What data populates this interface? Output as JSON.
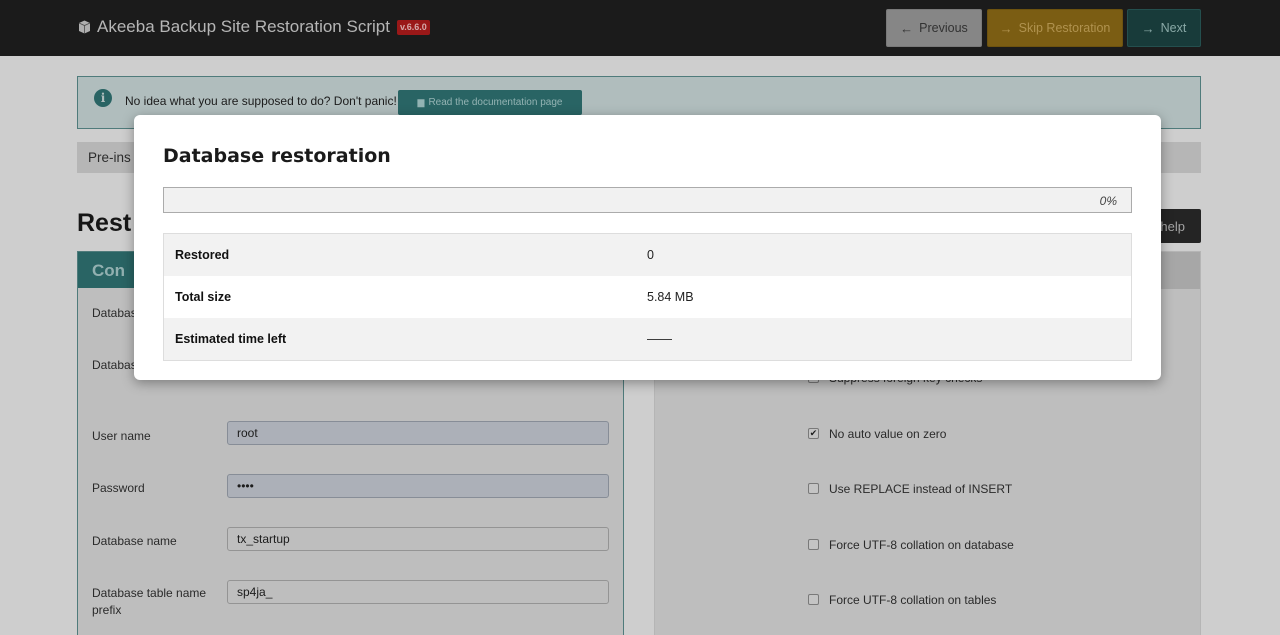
{
  "header": {
    "title": "Akeeba Backup Site Restoration Script",
    "version": "v.6.6.0",
    "buttons": {
      "previous": "Previous",
      "skip": "Skip Restoration",
      "next": "Next"
    }
  },
  "alert": {
    "text": "No idea what you are supposed to do? Don't panic!",
    "doc_button": "Read the documentation page"
  },
  "steps": {
    "current": "Pre-ins"
  },
  "section": {
    "title": "Rest",
    "help_button": "help"
  },
  "connection_panel": {
    "heading": "Con",
    "fields": [
      {
        "label": "Databas",
        "value": ""
      },
      {
        "label": "Databas name",
        "value": ""
      },
      {
        "label": "User name",
        "value": "root"
      },
      {
        "label": "Password",
        "value": "••••"
      },
      {
        "label": "Database name",
        "value": "tx_startup"
      },
      {
        "label": "Database table name prefix",
        "value": "sp4ja_"
      }
    ]
  },
  "options_panel": {
    "checkboxes": [
      {
        "label": "Suppress foreign key checks",
        "checked": false
      },
      {
        "label": "No auto value on zero",
        "checked": true
      },
      {
        "label": "Use REPLACE instead of INSERT",
        "checked": false
      },
      {
        "label": "Force UTF-8 collation on database",
        "checked": false
      },
      {
        "label": "Force UTF-8 collation on tables",
        "checked": false
      }
    ]
  },
  "modal": {
    "title": "Database restoration",
    "progress_percent": 0,
    "progress_label": "0%",
    "stats": [
      {
        "label": "Restored",
        "value": "0"
      },
      {
        "label": "Total size",
        "value": "5.84 MB"
      },
      {
        "label": "Estimated time left",
        "value": "——"
      }
    ]
  },
  "colors": {
    "primary": "#2f7272",
    "warning": "#e0a52b",
    "version_badge": "#b01c1c",
    "header_bg": "#1f1f1f"
  }
}
